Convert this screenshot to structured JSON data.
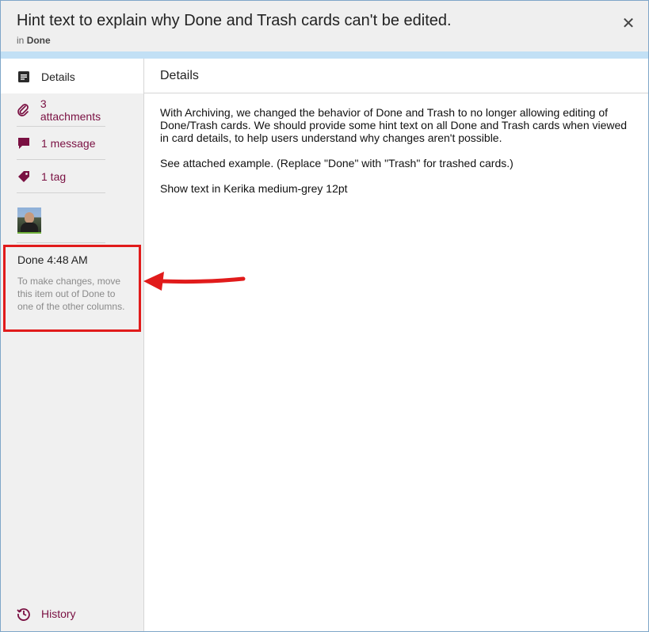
{
  "header": {
    "title": "Hint text to explain why Done and Trash cards can't be edited.",
    "subtitle_prefix": "in",
    "column": "Done",
    "close_symbol": "✕"
  },
  "sidebar": {
    "items": [
      {
        "label": "Details",
        "icon": "details-icon",
        "active": true
      },
      {
        "label": "3 attachments",
        "icon": "paperclip-icon"
      },
      {
        "label": "1 message",
        "icon": "chat-bubble-icon"
      },
      {
        "label": "1 tag",
        "icon": "tag-icon"
      }
    ],
    "done_time": "Done 4:48 AM",
    "hint_text": "To make changes, move this item out of Done to one of the other columns.",
    "history_label": "History"
  },
  "main": {
    "section_title": "Details",
    "paragraphs": [
      "With Archiving, we changed the behavior of Done and Trash to no longer allowing editing of Done/Trash cards. We should provide some hint text on all Done and Trash cards when viewed in card details, to help users understand why changes aren't possible.",
      "See attached example. (Replace \"Done\" with \"Trash\" for trashed cards.)",
      "Show text in Kerika medium-grey 12pt"
    ]
  },
  "colors": {
    "accent_link": "#7a1042",
    "header_bg": "#efefef",
    "blue_bar": "#c2e0f5",
    "annotation_red": "#e11b1b",
    "sidebar_bg": "#f0f0f0"
  }
}
